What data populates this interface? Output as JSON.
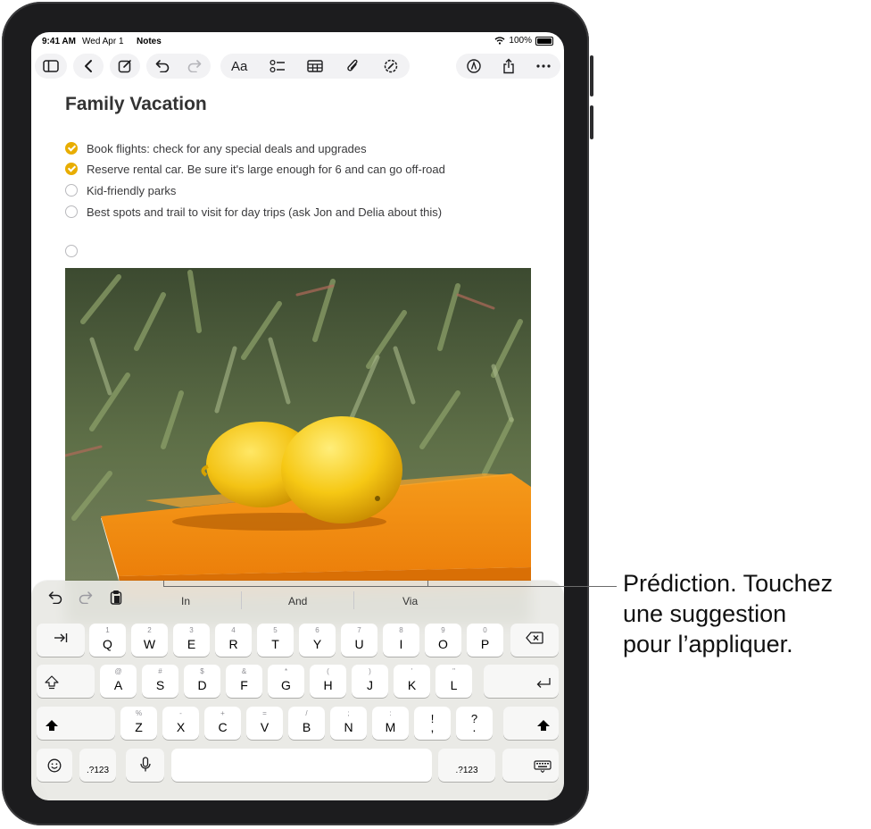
{
  "status": {
    "time": "9:41 AM",
    "date": "Wed Apr 1",
    "app": "Notes",
    "battery": "100%"
  },
  "toolbar": {
    "icons": [
      "sidebar-icon",
      "back-icon",
      "compose-icon",
      "undo-icon",
      "redo-icon",
      "format-icon",
      "checklist-icon",
      "table-icon",
      "attachment-icon",
      "markup-icon",
      "pen-icon",
      "share-icon",
      "more-icon"
    ],
    "format_label": "Aa"
  },
  "note": {
    "title": "Family Vacation",
    "checklist": [
      {
        "text": "Book flights: check for any special deals and upgrades",
        "checked": true
      },
      {
        "text": "Reserve rental car. Be sure it's large enough for 6 and can go off-road",
        "checked": true
      },
      {
        "text": "Kid-friendly parks",
        "checked": false
      },
      {
        "text": "Best spots and trail to visit for day trips (ask Jon and Delia about this)",
        "checked": false
      },
      {
        "text": "",
        "checked": false
      }
    ],
    "image": "photo of two lemons on an orange box in front of green succulents"
  },
  "keyboard": {
    "predictions": [
      "In",
      "And",
      "Via"
    ],
    "row1": [
      {
        "main": "Q",
        "sub": "1"
      },
      {
        "main": "W",
        "sub": "2"
      },
      {
        "main": "E",
        "sub": "3"
      },
      {
        "main": "R",
        "sub": "4"
      },
      {
        "main": "T",
        "sub": "5"
      },
      {
        "main": "Y",
        "sub": "6"
      },
      {
        "main": "U",
        "sub": "7"
      },
      {
        "main": "I",
        "sub": "8"
      },
      {
        "main": "O",
        "sub": "9"
      },
      {
        "main": "P",
        "sub": "0"
      }
    ],
    "row2": [
      {
        "main": "A",
        "sub": "@"
      },
      {
        "main": "S",
        "sub": "#"
      },
      {
        "main": "D",
        "sub": "$"
      },
      {
        "main": "F",
        "sub": "&"
      },
      {
        "main": "G",
        "sub": "*"
      },
      {
        "main": "H",
        "sub": "("
      },
      {
        "main": "J",
        "sub": ")"
      },
      {
        "main": "K",
        "sub": "'"
      },
      {
        "main": "L",
        "sub": "\""
      }
    ],
    "row3": [
      {
        "main": "Z",
        "sub": "%"
      },
      {
        "main": "X",
        "sub": "-"
      },
      {
        "main": "C",
        "sub": "+"
      },
      {
        "main": "V",
        "sub": "="
      },
      {
        "main": "B",
        "sub": "/"
      },
      {
        "main": "N",
        "sub": ";"
      },
      {
        "main": "M",
        "sub": ":"
      },
      {
        "main": ",",
        "sub": "!"
      },
      {
        "main": ".",
        "sub": "?"
      }
    ],
    "num_label": ".?123"
  },
  "callout": {
    "lines": [
      "Prédiction. Touchez",
      "une suggestion",
      "pour l’appliquer."
    ]
  }
}
